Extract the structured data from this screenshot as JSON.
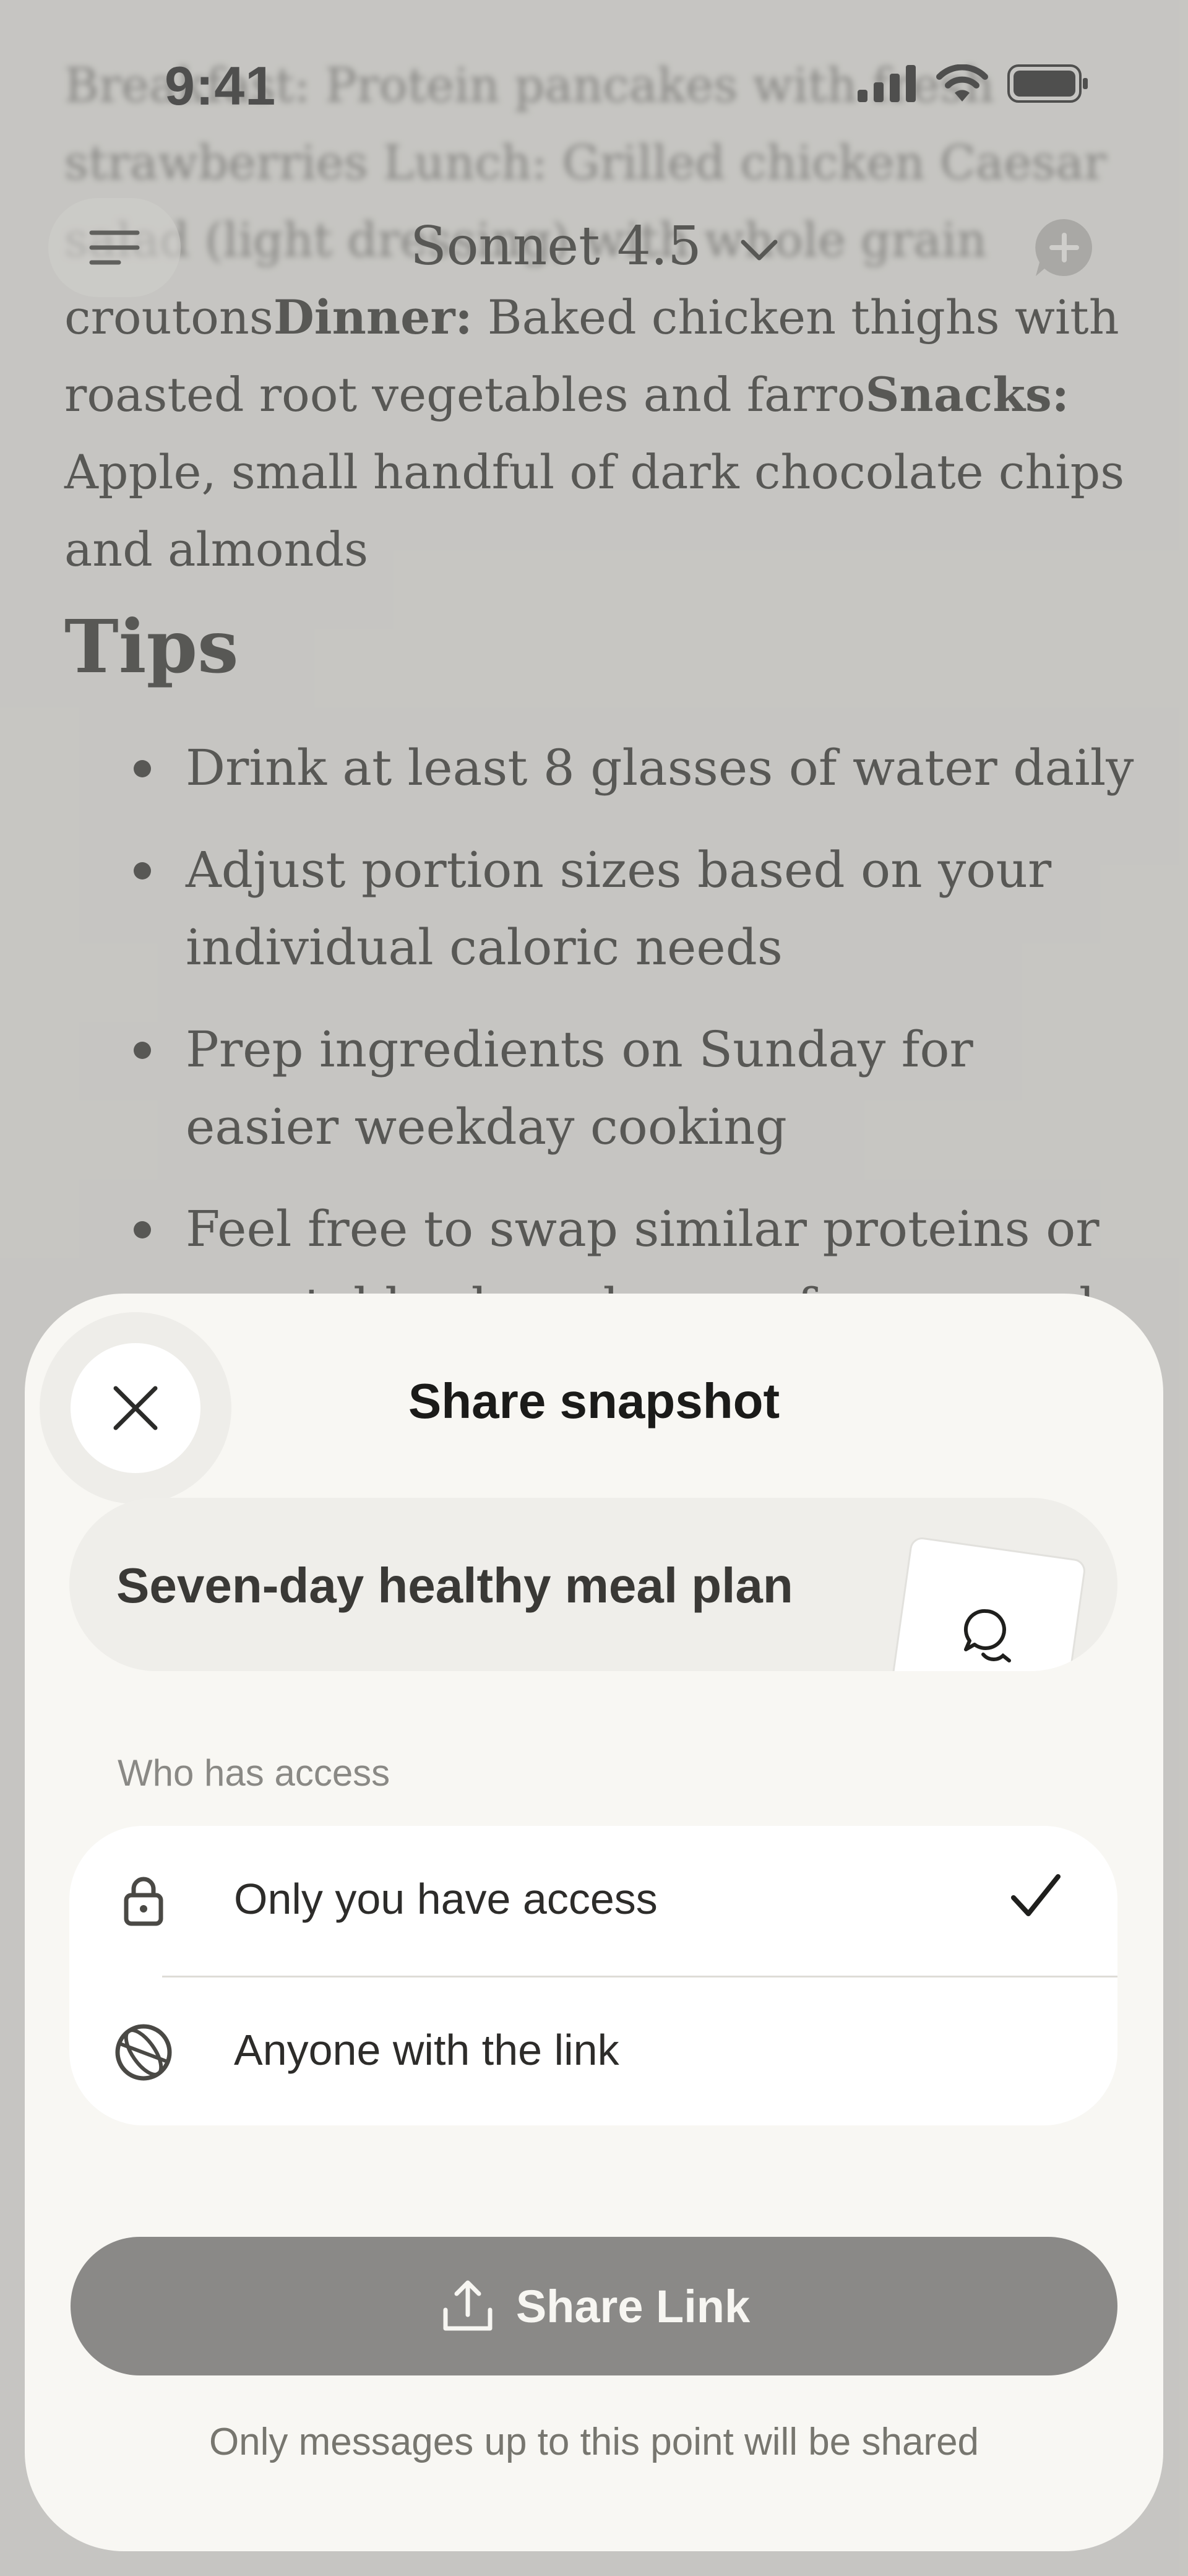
{
  "status_bar": {
    "time": "9:41"
  },
  "top_bar": {
    "model_name": "Sonnet 4.5"
  },
  "chat": {
    "blurred_line_1": "Breakfast: Protein pancakes with fresh",
    "blurred_line_2": "strawberries Lunch: Grilled chicken Caesar",
    "blurred_line_3": "salad (light dressing) with whole grain",
    "meal_text_1": "croutons",
    "meal_label_dinner": "Dinner:",
    "meal_text_2": " Baked chicken thighs with roasted root vegetables and farro",
    "meal_label_snacks": "Snacks:",
    "meal_text_3": " Apple, small handful of dark chocolate chips and almonds",
    "tips_heading": "Tips",
    "tips": [
      "Drink at least 8 glasses of water daily",
      "Adjust portion sizes based on your individual caloric needs",
      "Prep ingredients on Sunday for easier weekday cooking",
      "Feel free to swap similar proteins or vegetables based on preference and"
    ]
  },
  "sheet": {
    "title": "Share snapshot",
    "preview_title": "Seven-day healthy meal plan",
    "access_label": "Who has access",
    "options": [
      {
        "label": "Only you have access",
        "icon": "lock-icon",
        "selected": true
      },
      {
        "label": "Anyone with the link",
        "icon": "globe-icon",
        "selected": false
      }
    ],
    "share_button_label": "Share Link",
    "footnote": "Only messages up to this point will be shared"
  }
}
